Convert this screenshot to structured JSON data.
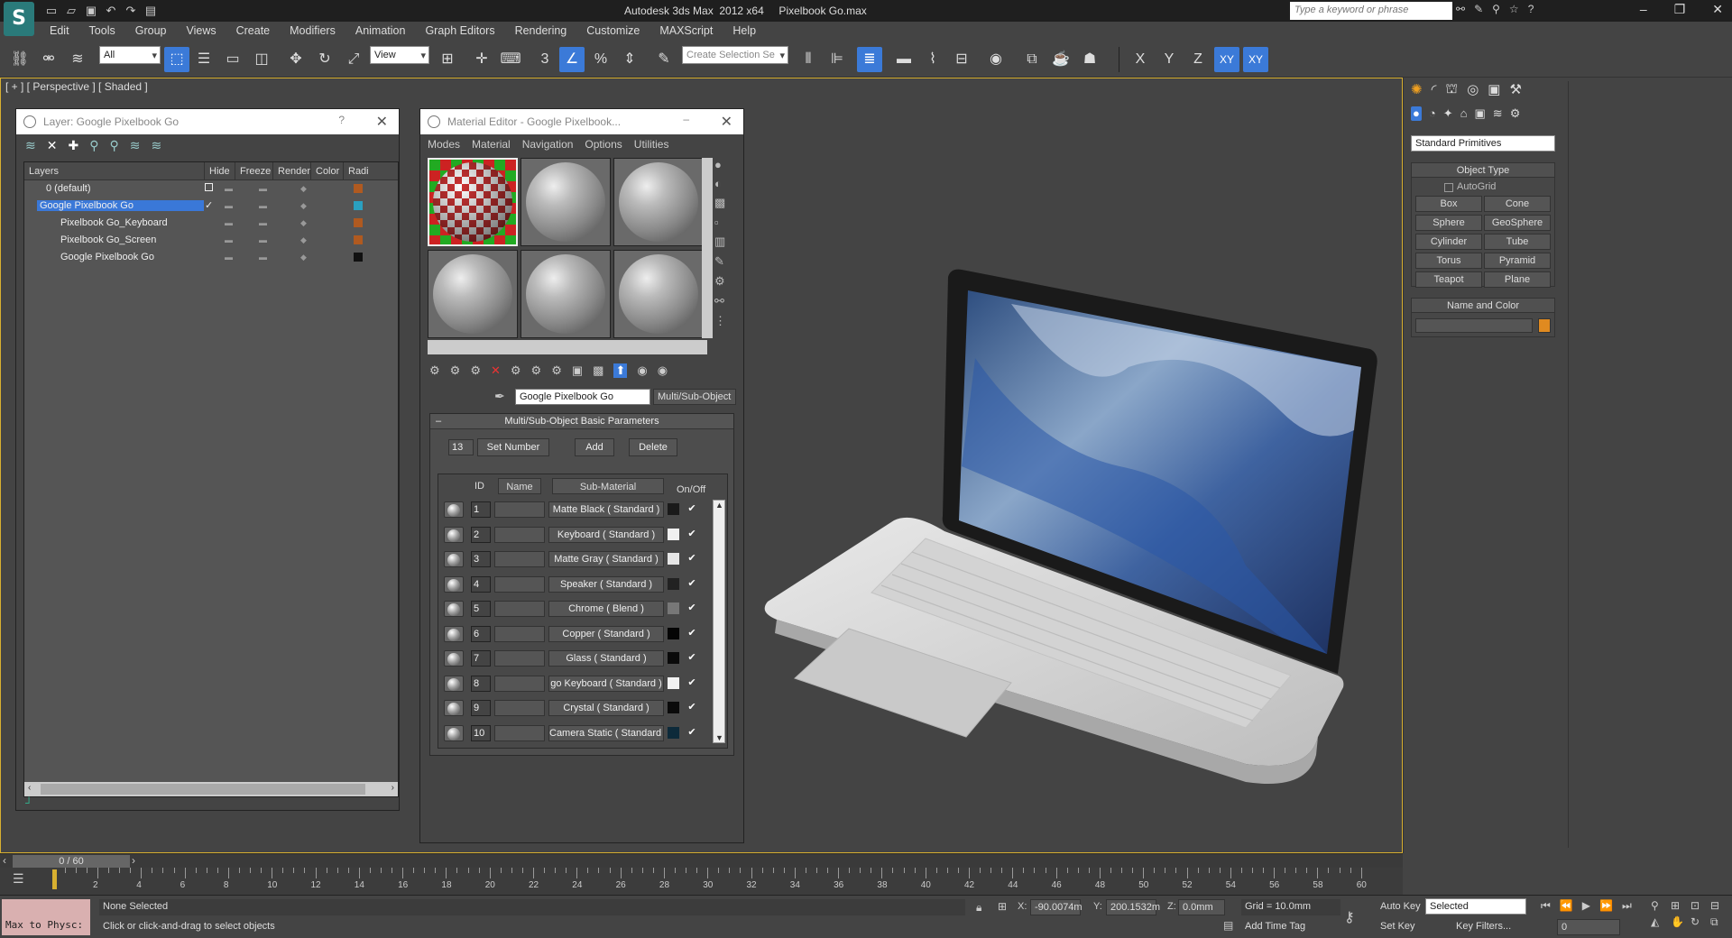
{
  "titlebar": {
    "app_letter": "S",
    "title": "Autodesk 3ds Max  2012 x64     Pixelbook Go.max",
    "search_placeholder": "Type a keyword or phrase",
    "qat_icons": [
      "new-icon",
      "open-icon",
      "save-icon",
      "undo-icon",
      "redo-icon",
      "project-icon"
    ],
    "help_icon": "?"
  },
  "menu": [
    "Edit",
    "Tools",
    "Group",
    "Views",
    "Create",
    "Modifiers",
    "Animation",
    "Graph Editors",
    "Rendering",
    "Customize",
    "MAXScript",
    "Help"
  ],
  "toolbar": {
    "filter_value": "All",
    "ref_coord_value": "View",
    "selection_set_placeholder": "Create Selection Se",
    "snap_num": "3",
    "axes": [
      "X",
      "Y",
      "Z",
      "XY",
      "XY"
    ]
  },
  "viewport": {
    "label": "[ + ] [ Perspective ] [ Shaded ]"
  },
  "layer_window": {
    "title": "Layer: Google Pixelbook Go",
    "help": "?",
    "columns": [
      "Layers",
      "Hide",
      "Freeze",
      "Render",
      "Color",
      "Radi"
    ],
    "rows": [
      {
        "name": "0 (default)",
        "color": "#b05a20"
      },
      {
        "name": "Google Pixelbook Go",
        "color": "#2aa0c0",
        "selected": true
      },
      {
        "name": "Pixelbook Go_Keyboard",
        "color": "#b05a20"
      },
      {
        "name": "Pixelbook Go_Screen",
        "color": "#b05a20"
      },
      {
        "name": "Google Pixelbook Go",
        "color": "#111111"
      }
    ]
  },
  "material_editor": {
    "title": "Material Editor - Google Pixelbook...",
    "menu": [
      "Modes",
      "Material",
      "Navigation",
      "Options",
      "Utilities"
    ],
    "material_name": "Google Pixelbook Go",
    "material_type": "Multi/Sub-Object",
    "rollout_title": "Multi/Sub-Object Basic Parameters",
    "count": "13",
    "set_number": "Set Number",
    "add": "Add",
    "delete": "Delete",
    "headers": {
      "id": "ID",
      "name": "Name",
      "sub": "Sub-Material",
      "onoff": "On/Off"
    },
    "rows": [
      {
        "id": "1",
        "sub": "Matte Black  ( Standard )",
        "color": "#1a1a1a"
      },
      {
        "id": "2",
        "sub": "Keyboard  ( Standard )",
        "color": "#f0f0f0"
      },
      {
        "id": "3",
        "sub": "Matte Gray  ( Standard )",
        "color": "#e6e6e6"
      },
      {
        "id": "4",
        "sub": "Speaker  ( Standard )",
        "color": "#222222"
      },
      {
        "id": "5",
        "sub": "Chrome  ( Blend )",
        "color": "#777777"
      },
      {
        "id": "6",
        "sub": "Copper  ( Standard )",
        "color": "#050505"
      },
      {
        "id": "7",
        "sub": "Glass  ( Standard )",
        "color": "#0a0a0a"
      },
      {
        "id": "8",
        "sub": "go Keyboard  ( Standard )",
        "color": "#f2f2f2"
      },
      {
        "id": "9",
        "sub": "Crystal  ( Standard )",
        "color": "#0a0a0a"
      },
      {
        "id": "10",
        "sub": "Camera Static  ( Standard )",
        "color": "#0d2a3a"
      }
    ]
  },
  "command_panel": {
    "dropdown": "Standard Primitives",
    "object_type_title": "Object Type",
    "autogrid": "AutoGrid",
    "buttons": [
      "Box",
      "Cone",
      "Sphere",
      "GeoSphere",
      "Cylinder",
      "Tube",
      "Torus",
      "Pyramid",
      "Teapot",
      "Plane"
    ],
    "name_color_title": "Name and Color",
    "swatch_color": "#e08a20"
  },
  "timeline": {
    "frame": "0 / 60",
    "ticks": [
      "2",
      "4",
      "6",
      "8",
      "10",
      "12",
      "14",
      "16",
      "18",
      "20",
      "22",
      "24",
      "26",
      "28",
      "30",
      "32",
      "34",
      "36",
      "38",
      "40",
      "42",
      "44",
      "46",
      "48",
      "50",
      "52",
      "54",
      "56",
      "58",
      "60"
    ]
  },
  "status": {
    "script_mini": "Max to Physc:",
    "selection": "None Selected",
    "prompt": "Click or click-and-drag to select objects",
    "x": "-90.0074m",
    "y": "200.1532m",
    "z": "0.0mm",
    "grid": "Grid = 10.0mm",
    "add_time_tag": "Add Time Tag",
    "auto_key": "Auto Key",
    "set_key": "Set Key",
    "selected": "Selected",
    "key_filters": "Key Filters...",
    "frame_field": "0"
  }
}
